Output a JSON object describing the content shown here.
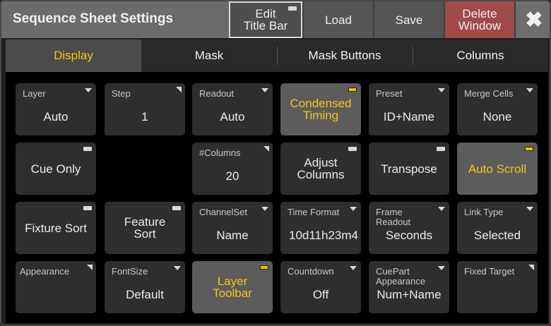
{
  "window": {
    "title": "Sequence Sheet Settings",
    "buttons": {
      "edit_title_bar_line1": "Edit",
      "edit_title_bar_line2": "Title Bar",
      "load": "Load",
      "save": "Save",
      "delete_line1": "Delete",
      "delete_line2": "Window",
      "close": "✖"
    }
  },
  "tabs": [
    "Display",
    "Mask",
    "Mask Buttons",
    "Columns"
  ],
  "cells": {
    "layer": {
      "label": "Layer",
      "value": "Auto"
    },
    "step": {
      "label": "Step",
      "value": "1"
    },
    "readout": {
      "label": "Readout",
      "value": "Auto"
    },
    "condensed_timing": {
      "line1": "Condensed",
      "line2": "Timing"
    },
    "preset": {
      "label": "Preset",
      "value": "ID+Name"
    },
    "merge_cells": {
      "label": "Merge Cells",
      "value": "None"
    },
    "cue_only": {
      "text": "Cue Only"
    },
    "columns_count": {
      "label": "#Columns",
      "value": "20"
    },
    "adjust_columns": {
      "line1": "Adjust",
      "line2": "Columns"
    },
    "transpose": {
      "text": "Transpose"
    },
    "auto_scroll": {
      "text": "Auto Scroll"
    },
    "fixture_sort": {
      "text": "Fixture Sort"
    },
    "feature_sort": {
      "line1": "Feature",
      "line2": "Sort"
    },
    "channelset": {
      "label": "ChannelSet",
      "value": "Name"
    },
    "time_format": {
      "label": "Time Format",
      "value": "10d11h23m4"
    },
    "frame_readout": {
      "label_line1": "Frame",
      "label_line2": "Readout",
      "value": "Seconds"
    },
    "link_type": {
      "label": "Link Type",
      "value": "Selected"
    },
    "appearance": {
      "label": "Appearance"
    },
    "fontsize": {
      "label": "FontSize",
      "value": "Default"
    },
    "layer_toolbar": {
      "line1": "Layer",
      "line2": "Toolbar"
    },
    "countdown": {
      "label": "Countdown",
      "value": "Off"
    },
    "cuepart_appearance": {
      "label_line1": "CuePart",
      "label_line2": "Appearance",
      "value": "Num+Name"
    },
    "fixed_target": {
      "label": "Fixed Target"
    }
  }
}
